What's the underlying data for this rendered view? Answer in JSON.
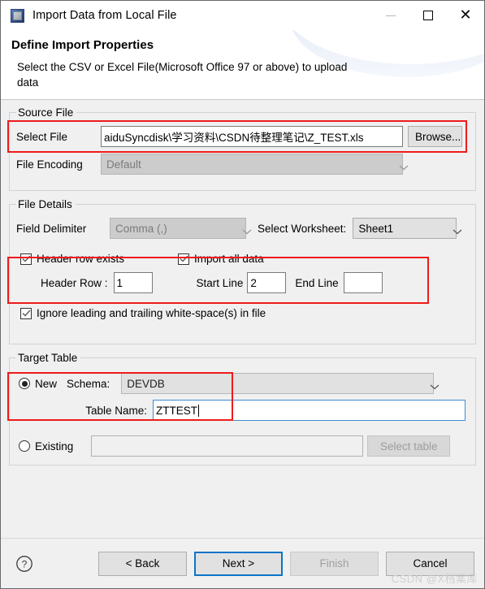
{
  "window": {
    "title": "Import Data from Local File",
    "icon": "app-window-icon",
    "minimize_label": "—",
    "maximize_label": "□",
    "close_label": "✕"
  },
  "header": {
    "title": "Define Import Properties",
    "subtitle": "Select the CSV or Excel File(Microsoft Office 97 or above) to upload data"
  },
  "source_file": {
    "legend": "Source File",
    "select_file_label": "Select File",
    "select_file_value": "aiduSyncdisk\\学习资料\\CSDN待整理笔记\\Z_TEST.xls",
    "browse_label": "Browse...",
    "file_encoding_label": "File Encoding",
    "file_encoding_value": "Default"
  },
  "file_details": {
    "legend": "File Details",
    "field_delimiter_label": "Field Delimiter",
    "field_delimiter_value": "Comma (,)",
    "select_worksheet_label": "Select Worksheet:",
    "select_worksheet_value": "Sheet1",
    "header_row_exists_label": "Header row exists",
    "header_row_exists_checked": true,
    "import_all_data_label": "Import all data",
    "import_all_data_checked": true,
    "header_row_label": "Header Row :",
    "header_row_value": "1",
    "start_line_label": "Start Line",
    "start_line_value": "2",
    "end_line_label": "End Line",
    "end_line_value": "",
    "ignore_whitespace_label": "Ignore leading and trailing white-space(s) in file",
    "ignore_whitespace_checked": true
  },
  "target_table": {
    "legend": "Target Table",
    "new_label": "New",
    "new_selected": true,
    "schema_label": "Schema:",
    "schema_value": "DEVDB",
    "table_name_label": "Table Name:",
    "table_name_value": "ZTTEST",
    "existing_label": "Existing",
    "existing_selected": false,
    "existing_value": "",
    "select_table_label": "Select table"
  },
  "footer": {
    "help_label": "?",
    "back_label": "< Back",
    "next_label": "Next >",
    "finish_label": "Finish",
    "cancel_label": "Cancel",
    "watermark": "CSDN @X档案库"
  },
  "colors": {
    "annotation": "#ee1b1b",
    "focus_blue": "#0a74c8",
    "dialog_bg": "#f0f0f0"
  }
}
